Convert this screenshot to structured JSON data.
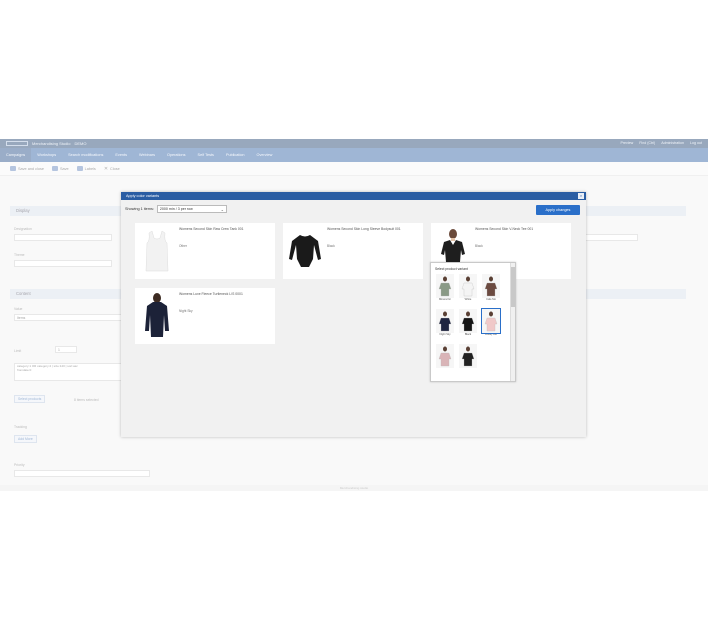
{
  "app": {
    "brand": "Merchandising Studio",
    "crumb": "DEMO",
    "top_links": [
      "Preview",
      "Find (Ctrl)",
      "Administration",
      "Log out"
    ]
  },
  "nav": [
    "Campaigns",
    "Workshops",
    "Search modifications",
    "Events",
    "Webinars",
    "Operations",
    "Self Tests",
    "Publication",
    "Overview"
  ],
  "toolbar": {
    "save_close": "Save and close",
    "save": "Save",
    "labels": "Labels",
    "close": "Close"
  },
  "form": {
    "display_header": "Display",
    "designation_label": "Designation",
    "theme_label": "Theme",
    "content_header": "Content",
    "value_label": "Value",
    "value": "Items",
    "limit_label": "Limit",
    "limit_value": "1",
    "query_text": "category:1 OR category:2 | size:120 | sort:asc\nfromdate:0",
    "select_products_btn": "Select products",
    "select_products_note": "8 items selected",
    "tracking_label": "Tracking",
    "add_btn": "Add More",
    "priority_label": "Priority",
    "status_text": "Merchandising studio"
  },
  "modal": {
    "title": "Apply color variants",
    "display_label": "Showing 1 items:",
    "display_value": "2000 min / 3 per row",
    "apply_label": "Apply changes",
    "cards": [
      {
        "name": "Womens Second Skin Raw Crew Tank 001",
        "brand": "Other",
        "color": "#f2f2f2"
      },
      {
        "name": "Womens Second Skin Long Sleeve Bodysuit 001",
        "brand": "Black",
        "color": "#1a1a1a"
      },
      {
        "name": "Womens Second Skin V-Neck Tee 001",
        "brand": "Black",
        "color": "#1e1e1e"
      },
      {
        "name": "Womens Luxe Fleece Turtleneck L/S 0001",
        "brand": "Night Sky",
        "color": "#1c2238"
      }
    ],
    "popup": {
      "title": "Select product variant",
      "swatches": [
        {
          "label": "Mineral Gr",
          "color": "#8a9a86"
        },
        {
          "label": "White",
          "color": "#f4f4f4"
        },
        {
          "label": "Cafe Mo",
          "color": "#6b4a40"
        },
        {
          "label": "Night Sky",
          "color": "#1f2540"
        },
        {
          "label": "Black",
          "color": "#151515"
        },
        {
          "label": "Rosey Blu",
          "color": "#f0c9c9"
        },
        {
          "label": "",
          "color": "#d9b4b7"
        },
        {
          "label": "",
          "color": "#222222"
        }
      ]
    }
  }
}
